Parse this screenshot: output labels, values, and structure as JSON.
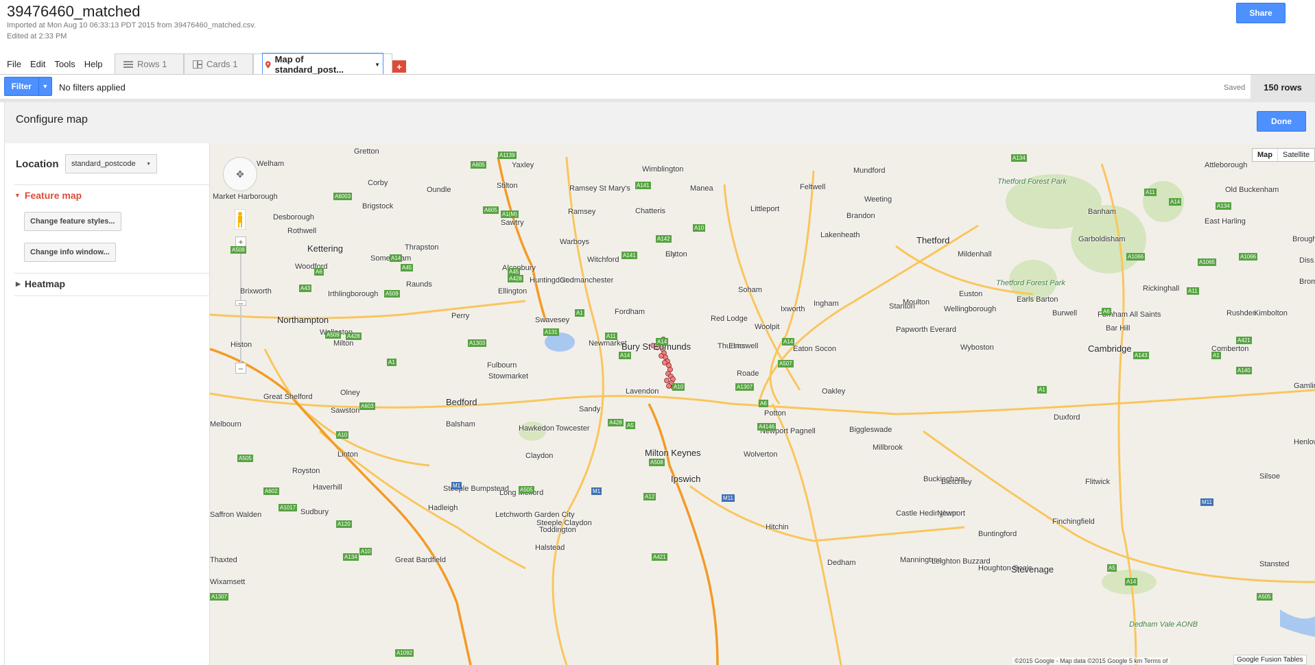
{
  "header": {
    "title": "39476460_matched",
    "imported": "Imported at Mon Aug 10 06:33:13 PDT 2015 from 39476460_matched.csv.",
    "edited": "Edited at 2:33 PM",
    "share_label": "Share"
  },
  "menu": [
    "File",
    "Edit",
    "Tools",
    "Help"
  ],
  "tabs": {
    "rows": "Rows 1",
    "cards": "Cards 1",
    "map": "Map of standard_post...",
    "add": "+"
  },
  "filterbar": {
    "filter_label": "Filter",
    "status": "No filters applied",
    "saved": "Saved",
    "row_count": "150 rows"
  },
  "config": {
    "title": "Configure map",
    "done_label": "Done"
  },
  "sidebar": {
    "location_label": "Location",
    "location_value": "standard_postcode",
    "feature_map": "Feature map",
    "change_styles": "Change feature styles...",
    "change_info": "Change info window...",
    "heatmap": "Heatmap"
  },
  "map": {
    "type_map": "Map",
    "type_satellite": "Satellite",
    "copyright": "©2015 Google - Map data ©2015 Google   5 km          Terms of",
    "fusion": "Google Fusion Tables",
    "places": [
      "Welham",
      "Gretton",
      "Corby",
      "Oundle",
      "Yaxley",
      "Wimblington",
      "Mundford",
      "Attleborough",
      "Market Harborough",
      "Desborough",
      "Rothwell",
      "Brigstock",
      "Stilton",
      "Ramsey St Mary's",
      "Manea",
      "Feltwell",
      "Weeting",
      "Old Buckenham",
      "Sawtry",
      "Ramsey",
      "Chatteris",
      "Littleport",
      "Brandon",
      "Banham",
      "East Harling",
      "Kettering",
      "Thrapston",
      "Warboys",
      "Sutton",
      "Lakenheath",
      "Thetford",
      "Garboldisham",
      "Broughton",
      "Woodford",
      "Somersham",
      "Witchford",
      "Ely",
      "Euston",
      "Diss",
      "Brixworth",
      "Raunds",
      "Alconbury",
      "Mildenhall",
      "Rickinghall",
      "Brome",
      "Irthlingborough",
      "Ellington",
      "Huntingdon",
      "Godmanchester",
      "Soham",
      "Stanton",
      "Wellingborough",
      "Rushden",
      "Kimbolton",
      "Perry",
      "Swavesey",
      "Fordham",
      "Red Lodge",
      "Ingham",
      "Ixworth",
      "Moulton",
      "Earls Barton",
      "Burwell",
      "Fornham All Saints",
      "Northampton",
      "Wollaston",
      "Papworth Everard",
      "Bar Hill",
      "Histon",
      "Milton",
      "Newmarket",
      "Bury St Edmunds",
      "Thurston",
      "Elmswell",
      "Woolpit",
      "Eaton Socon",
      "Wyboston",
      "Cambridge",
      "Comberton",
      "Fulbourn",
      "Stowmarket",
      "Roade",
      "Lavendon",
      "Oakley",
      "Gamlingay",
      "Great Shelford",
      "Olney",
      "Bedford",
      "Sandy",
      "Potton",
      "Sawston",
      "Balsham",
      "Hawkedon",
      "Towcester",
      "Newport Pagnell",
      "Biggleswade",
      "Duxford",
      "Melbourn",
      "Linton",
      "Claydon",
      "Wolverton",
      "Milton Keynes",
      "Millbrook",
      "Henlow",
      "Royston",
      "Haverhill",
      "Steeple Bumpstead",
      "Long Melford",
      "Ipswich",
      "Buckingham",
      "Bletchley",
      "Flitwick",
      "Silsoe",
      "Saffron Walden",
      "Sudbury",
      "Hadleigh",
      "Letchworth Garden City",
      "Castle Hedingham",
      "Newport",
      "Finchingfield",
      "Steeple Claydon",
      "Toddington",
      "Hitchin",
      "Buntingford",
      "Thaxted",
      "Great Bardfield",
      "Halstead",
      "Dedham",
      "Manningtree",
      "Leighton Buzzard",
      "Houghton Regis",
      "Stevenage",
      "Stansted",
      "Wixamsett"
    ],
    "parks": [
      "Thetford Forest Park",
      "Thetford Forest Park",
      "Dedham Vale AONB"
    ],
    "roads": [
      "A605",
      "A1139",
      "A6003",
      "A605",
      "A1(M)",
      "A141",
      "A134",
      "A11",
      "A134",
      "A14",
      "A508",
      "A14",
      "A45",
      "A43",
      "A6",
      "A509",
      "A141",
      "A142",
      "A10",
      "A1065",
      "A1066",
      "A1066",
      "A143",
      "A1",
      "A14",
      "A11",
      "A6",
      "A45",
      "A428",
      "A509",
      "A428",
      "A1",
      "A428",
      "A14",
      "A10",
      "A14",
      "A1",
      "A140",
      "A421",
      "A1",
      "A603",
      "A505",
      "A1303",
      "A11",
      "A1307",
      "A5",
      "A508",
      "A6",
      "A505",
      "A10",
      "A1017",
      "A131",
      "A12",
      "A421",
      "A4146",
      "A507",
      "A5",
      "A505",
      "A602",
      "A10",
      "A120",
      "A134",
      "A1092",
      "M1",
      "M1",
      "M11",
      "M11",
      "A14",
      "A1307"
    ]
  }
}
